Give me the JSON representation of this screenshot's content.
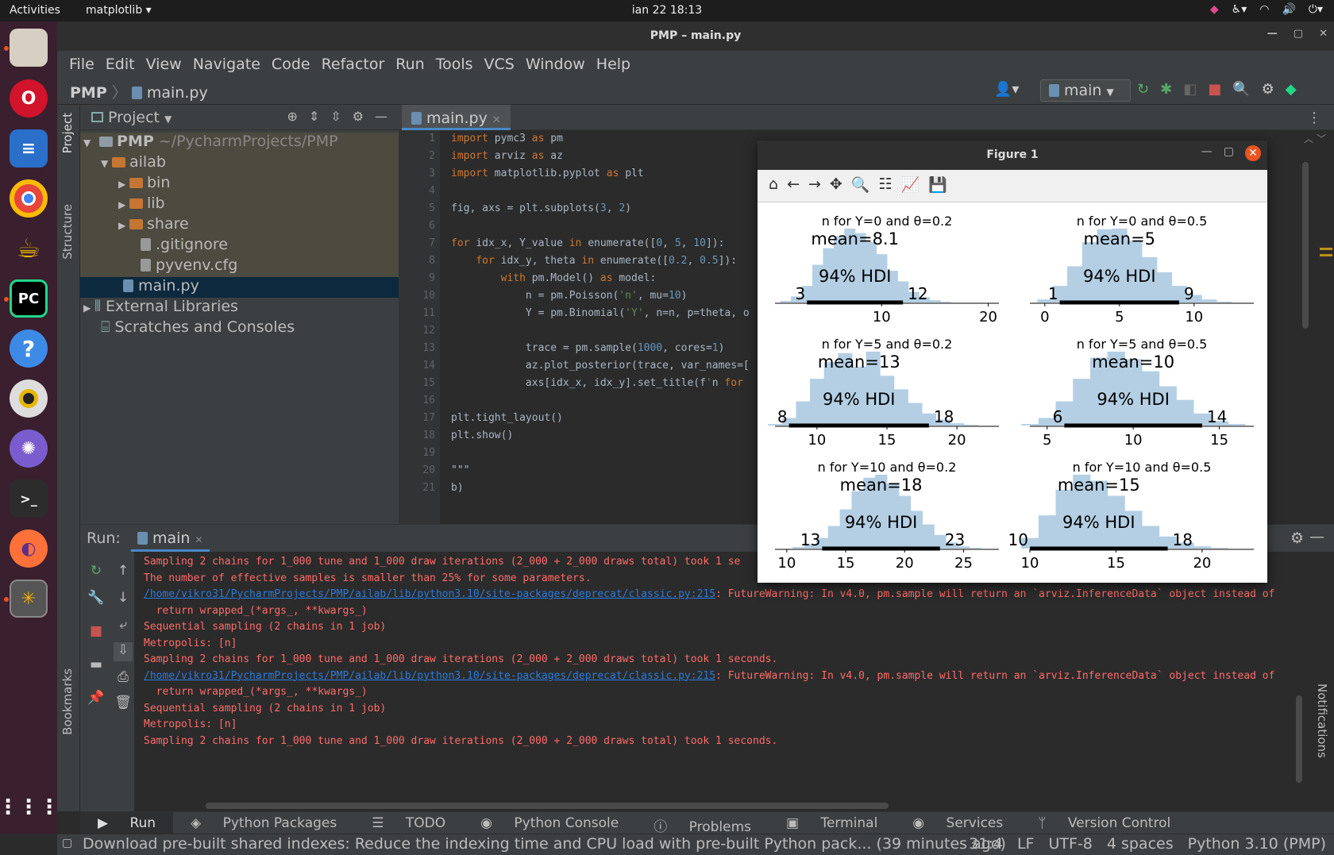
{
  "topbar": {
    "activities": "Activities",
    "app_menu": "matplotlib ▾",
    "clock": "ian 22  18:13"
  },
  "dock": {
    "items": [
      "files-icon",
      "opera-icon",
      "writer-icon",
      "chrome-icon",
      "teapot-icon",
      "pycharm-icon",
      "help-icon",
      "rhythmbox-icon",
      "network-icon",
      "terminal-icon",
      "firefox-icon",
      "inkscape-icon",
      "apps-grid-icon"
    ]
  },
  "window": {
    "title": "PMP – main.py",
    "menu": [
      "File",
      "Edit",
      "View",
      "Navigate",
      "Code",
      "Refactor",
      "Run",
      "Tools",
      "VCS",
      "Window",
      "Help"
    ],
    "breadcrumb": {
      "project": "PMP",
      "file": "main.py"
    },
    "run_config": "main",
    "project_panel": {
      "title": "Project",
      "items": [
        {
          "label": "PMP",
          "extra": "~/PycharmProjects/PMP"
        },
        {
          "label": "ailab"
        },
        {
          "label": "bin"
        },
        {
          "label": "lib"
        },
        {
          "label": "share"
        },
        {
          "label": ".gitignore"
        },
        {
          "label": "pyvenv.cfg"
        },
        {
          "label": "main.py"
        },
        {
          "label": "External Libraries"
        },
        {
          "label": "Scratches and Consoles"
        }
      ]
    },
    "side_tabs": {
      "project": "Project",
      "structure": "Structure",
      "bookmarks": "Bookmarks",
      "notifications": "Notifications"
    },
    "editor_tab": "main.py",
    "code_lines": [
      {
        "n": "1",
        "t": "import pymc3 as pm"
      },
      {
        "n": "2",
        "t": "import arviz as az"
      },
      {
        "n": "3",
        "t": "import matplotlib.pyplot as plt"
      },
      {
        "n": "4",
        "t": ""
      },
      {
        "n": "5",
        "t": "fig, axs = plt.subplots(3, 2)"
      },
      {
        "n": "6",
        "t": ""
      },
      {
        "n": "7",
        "t": "for idx_x, Y_value in enumerate([0, 5, 10]):"
      },
      {
        "n": "8",
        "t": "    for idx_y, theta in enumerate([0.2, 0.5]):"
      },
      {
        "n": "9",
        "t": "        with pm.Model() as model:"
      },
      {
        "n": "10",
        "t": "            n = pm.Poisson('n', mu=10)"
      },
      {
        "n": "11",
        "t": "            Y = pm.Binomial('Y', n=n, p=theta, o"
      },
      {
        "n": "12",
        "t": ""
      },
      {
        "n": "13",
        "t": "            trace = pm.sample(1000, cores=1)"
      },
      {
        "n": "14",
        "t": "            az.plot_posterior(trace, var_names=["
      },
      {
        "n": "15",
        "t": "            axs[idx_x, idx_y].set_title(f'n for"
      },
      {
        "n": "16",
        "t": ""
      },
      {
        "n": "17",
        "t": "plt.tight_layout()"
      },
      {
        "n": "18",
        "t": "plt.show()"
      },
      {
        "n": "19",
        "t": ""
      },
      {
        "n": "20",
        "t": "\"\"\""
      },
      {
        "n": "21",
        "t": "b)"
      }
    ],
    "run": {
      "label": "Run:",
      "tab": "main",
      "console": [
        {
          "t": "Sampling 2 chains for 1_000 tune and 1_000 draw iterations (2_000 + 2_000 draws total) took 1 se",
          "link": ""
        },
        {
          "t": "The number of effective samples is smaller than 25% for some parameters.",
          "link": ""
        },
        {
          "t": ": FutureWarning: In v4.0, pm.sample will return an `arviz.InferenceData` object instead of",
          "link": "/home/vikro31/PycharmProjects/PMP/ailab/lib/python3.10/site-packages/deprecat/classic.py:215"
        },
        {
          "t": "  return wrapped_(*args_, **kwargs_)",
          "link": ""
        },
        {
          "t": "Sequential sampling (2 chains in 1 job)",
          "link": ""
        },
        {
          "t": "Metropolis: [n]",
          "link": ""
        },
        {
          "t": "Sampling 2 chains for 1_000 tune and 1_000 draw iterations (2_000 + 2_000 draws total) took 1 seconds.",
          "link": ""
        },
        {
          "t": ": FutureWarning: In v4.0, pm.sample will return an `arviz.InferenceData` object instead of",
          "link": "/home/vikro31/PycharmProjects/PMP/ailab/lib/python3.10/site-packages/deprecat/classic.py:215"
        },
        {
          "t": "  return wrapped_(*args_, **kwargs_)",
          "link": ""
        },
        {
          "t": "Sequential sampling (2 chains in 1 job)",
          "link": ""
        },
        {
          "t": "Metropolis: [n]",
          "link": ""
        },
        {
          "t": "Sampling 2 chains for 1_000 tune and 1_000 draw iterations (2_000 + 2_000 draws total) took 1 seconds.",
          "link": ""
        }
      ]
    },
    "bottom_tabs": [
      "Run",
      "Python Packages",
      "TODO",
      "Python Console",
      "Problems",
      "Terminal",
      "Services",
      "Version Control"
    ],
    "status": {
      "message": "Download pre-built shared indexes: Reduce the indexing time and CPU load with pre-built Python pack... (39 minutes ago)",
      "position": "31:4",
      "line_sep": "LF",
      "encoding": "UTF-8",
      "indent": "4 spaces",
      "interpreter": "Python 3.10 (PMP)"
    }
  },
  "figure": {
    "title": "Figure 1",
    "toolbar": [
      "home-icon",
      "back-icon",
      "forward-icon",
      "pan-icon",
      "zoom-icon",
      "configure-icon",
      "edit-axes-icon",
      "save-icon"
    ]
  },
  "chart_data": [
    {
      "type": "bar",
      "title": "n for Y=0 and θ=0.2",
      "mean_label": "mean=8.1",
      "hdi_label": "94% HDI",
      "hdi": [
        3,
        12
      ],
      "hdi_low_label": "3",
      "hdi_high_label": "12",
      "xlim": [
        0,
        21
      ],
      "ticks": [
        10,
        20
      ],
      "bins": [
        0,
        1,
        2,
        3,
        4,
        5,
        6,
        7,
        8,
        9,
        10,
        11,
        12,
        13,
        14,
        15,
        16,
        17,
        18,
        19,
        20
      ],
      "values": [
        0,
        0.02,
        0.08,
        0.22,
        0.5,
        0.72,
        0.88,
        0.98,
        0.92,
        0.8,
        0.64,
        0.42,
        0.28,
        0.14,
        0.07,
        0.03,
        0.01,
        0,
        0,
        0,
        0
      ]
    },
    {
      "type": "bar",
      "title": "n for Y=0 and θ=0.5",
      "mean_label": "mean=5",
      "hdi_label": "94% HDI",
      "hdi": [
        1,
        9
      ],
      "hdi_low_label": "1",
      "hdi_high_label": "9",
      "xlim": [
        -1,
        14
      ],
      "ticks": [
        0,
        5,
        10
      ],
      "bins": [
        0,
        1,
        2,
        3,
        4,
        5,
        6,
        7,
        8,
        9,
        10,
        11,
        12,
        13
      ],
      "values": [
        0.04,
        0.22,
        0.48,
        0.8,
        0.97,
        0.98,
        0.82,
        0.6,
        0.4,
        0.22,
        0.1,
        0.04,
        0.01,
        0
      ]
    },
    {
      "type": "bar",
      "title": "n for Y=5 and θ=0.2",
      "mean_label": "mean=13",
      "hdi_label": "94% HDI",
      "hdi": [
        8,
        18
      ],
      "hdi_low_label": "8",
      "hdi_high_label": "18",
      "xlim": [
        7,
        23
      ],
      "ticks": [
        10,
        15,
        20
      ],
      "bins": [
        7,
        8,
        9,
        10,
        11,
        12,
        13,
        14,
        15,
        16,
        17,
        18,
        19,
        20,
        21,
        22
      ],
      "values": [
        0.02,
        0.1,
        0.32,
        0.62,
        0.84,
        0.96,
        0.78,
        0.98,
        0.66,
        0.48,
        0.3,
        0.16,
        0.08,
        0.03,
        0.01,
        0
      ]
    },
    {
      "type": "bar",
      "title": "n for Y=5 and θ=0.5",
      "mean_label": "mean=10",
      "hdi_label": "94% HDI",
      "hdi": [
        6,
        14
      ],
      "hdi_low_label": "6",
      "hdi_high_label": "14",
      "xlim": [
        4,
        17
      ],
      "ticks": [
        5,
        10,
        15
      ],
      "bins": [
        4,
        5,
        6,
        7,
        8,
        9,
        10,
        11,
        12,
        13,
        14,
        15,
        16
      ],
      "values": [
        0.02,
        0.1,
        0.32,
        0.62,
        0.9,
        0.98,
        0.88,
        0.72,
        0.52,
        0.34,
        0.16,
        0.06,
        0.02
      ]
    },
    {
      "type": "bar",
      "title": "n for Y=10 and θ=0.2",
      "mean_label": "mean=18",
      "hdi_label": "94% HDI",
      "hdi": [
        13,
        23
      ],
      "hdi_low_label": "13",
      "hdi_high_label": "23",
      "xlim": [
        9,
        28
      ],
      "ticks": [
        10,
        15,
        20,
        25
      ],
      "bins": [
        10,
        11,
        12,
        13,
        14,
        15,
        16,
        17,
        18,
        19,
        20,
        21,
        22,
        23,
        24,
        25,
        26,
        27
      ],
      "values": [
        0,
        0.02,
        0.06,
        0.14,
        0.3,
        0.52,
        0.76,
        0.94,
        0.98,
        0.86,
        0.7,
        0.5,
        0.32,
        0.18,
        0.08,
        0.03,
        0.01,
        0
      ]
    },
    {
      "type": "bar",
      "title": "n for Y=10 and θ=0.5",
      "mean_label": "mean=15",
      "hdi_label": "94% HDI",
      "hdi": [
        10,
        18
      ],
      "hdi_low_label": "10",
      "hdi_high_label": "18",
      "xlim": [
        10,
        23
      ],
      "ticks": [
        10,
        15,
        20
      ],
      "bins": [
        10,
        11,
        12,
        13,
        14,
        15,
        16,
        17,
        18,
        19,
        20,
        21,
        22
      ],
      "values": [
        0.14,
        0.44,
        0.78,
        0.98,
        0.9,
        0.7,
        0.5,
        0.3,
        0.16,
        0.08,
        0.03,
        0.01,
        0
      ]
    }
  ]
}
